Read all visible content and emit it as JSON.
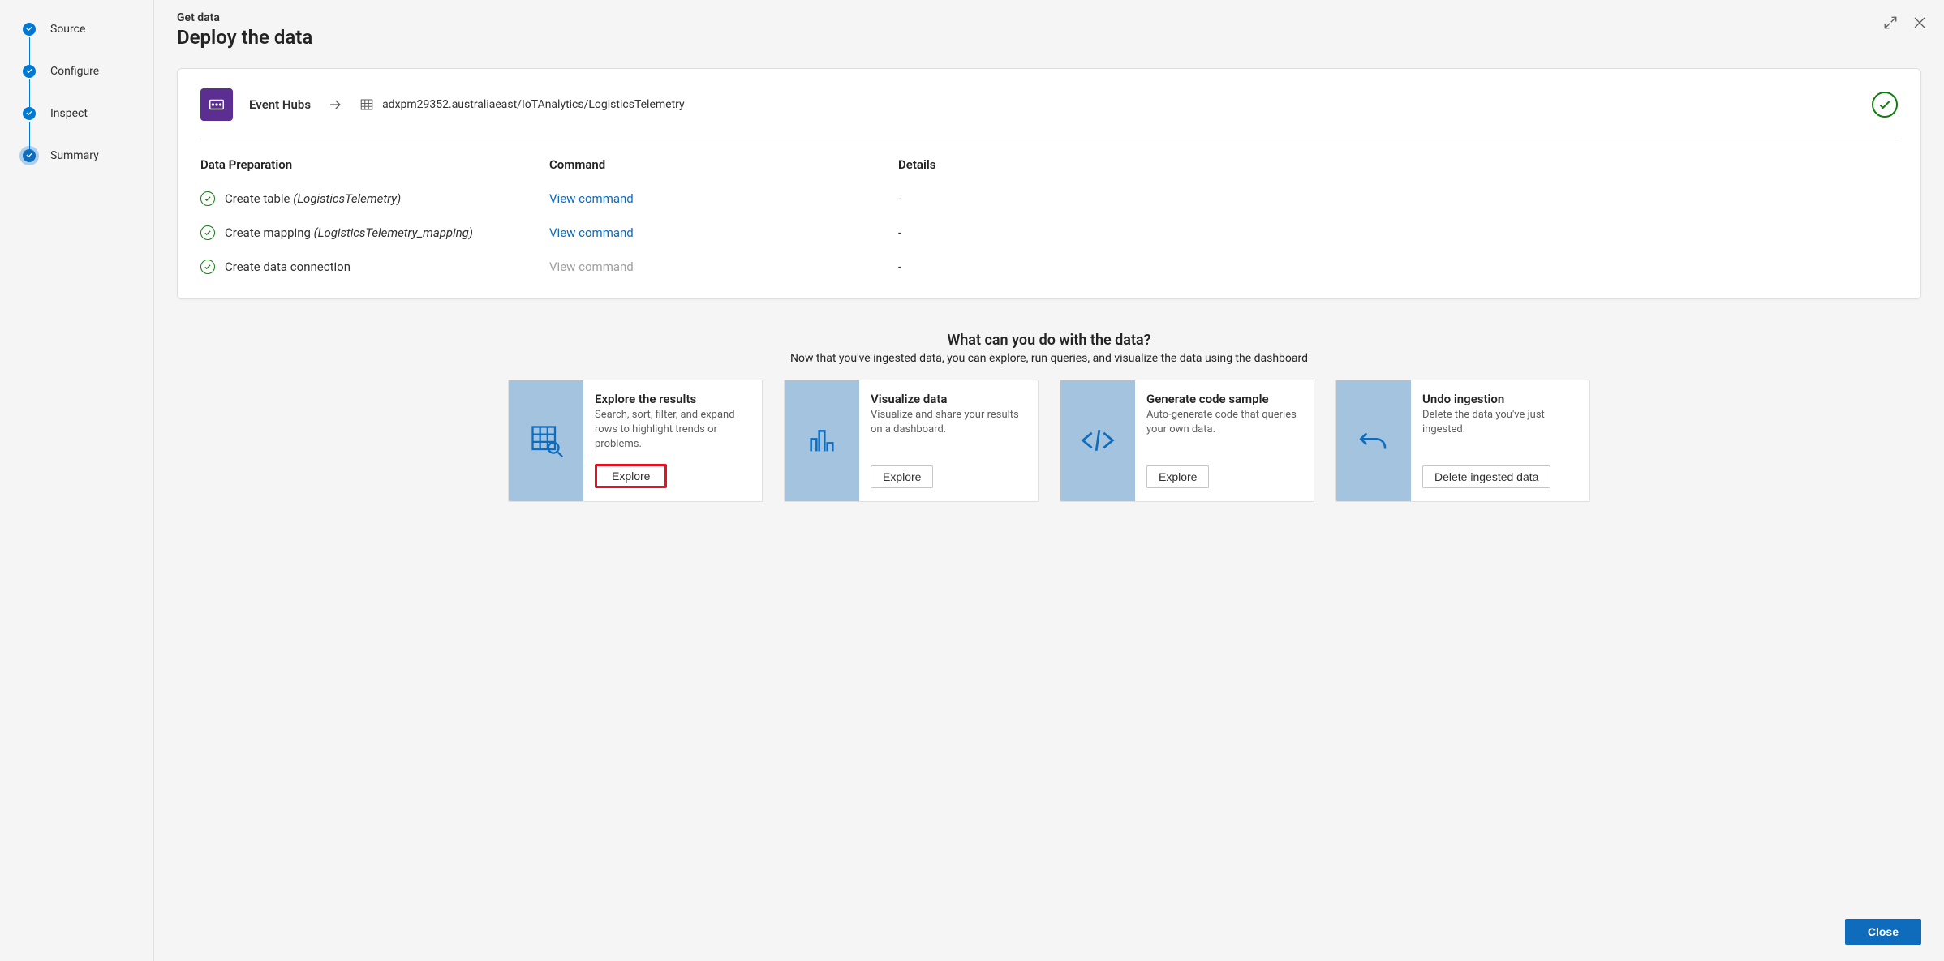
{
  "stepper": [
    "Source",
    "Configure",
    "Inspect",
    "Summary"
  ],
  "activeStep": 3,
  "eyebrow": "Get data",
  "pageTitle": "Deploy the data",
  "connection": {
    "source": "Event Hubs",
    "target": "adxpm29352.australiaeast/IoTAnalytics/LogisticsTelemetry"
  },
  "prepHeaders": {
    "col0": "Data Preparation",
    "col1": "Command",
    "col2": "Details"
  },
  "prepRows": [
    {
      "labelPrefix": "Create table ",
      "labelItalic": "(LogisticsTelemetry)",
      "command": "View command",
      "disabled": false,
      "details": "-"
    },
    {
      "labelPrefix": "Create mapping ",
      "labelItalic": "(LogisticsTelemetry_mapping)",
      "command": "View command",
      "disabled": false,
      "details": "-"
    },
    {
      "labelPrefix": "Create data connection",
      "labelItalic": "",
      "command": "View command",
      "disabled": true,
      "details": "-"
    }
  ],
  "nextTitle": "What can you do with the data?",
  "nextSub": "Now that you've ingested data, you can explore, run queries, and visualize the data using the dashboard",
  "actions": [
    {
      "id": "explore-results",
      "title": "Explore the results",
      "desc": "Search, sort, filter, and expand rows to highlight trends or problems.",
      "button": "Explore",
      "icon": "table-search",
      "highlight": true
    },
    {
      "id": "visualize",
      "title": "Visualize data",
      "desc": "Visualize and share your results on a dashboard.",
      "button": "Explore",
      "icon": "bar-chart",
      "highlight": false
    },
    {
      "id": "codegen",
      "title": "Generate code sample",
      "desc": "Auto-generate code that queries your own data.",
      "button": "Explore",
      "icon": "code",
      "highlight": false
    },
    {
      "id": "undo",
      "title": "Undo ingestion",
      "desc": "Delete the data you've just ingested.",
      "button": "Delete ingested data",
      "icon": "undo",
      "highlight": false
    }
  ],
  "closeLabel": "Close"
}
